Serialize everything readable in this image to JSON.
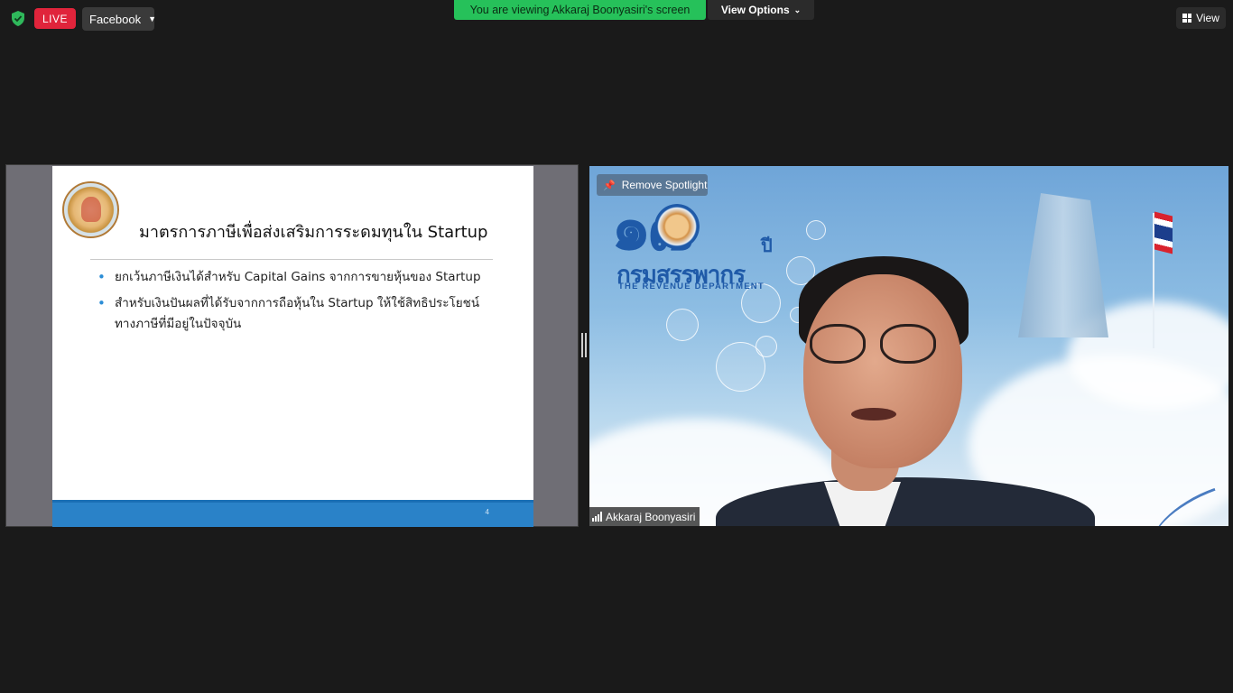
{
  "toolbar": {
    "live_label": "LIVE",
    "stream_target": "Facebook",
    "viewing_banner": "You are viewing Akkaraj Boonyasiri's screen",
    "view_options_label": "View Options",
    "view_label": "View"
  },
  "slide": {
    "title": "มาตรการภาษีเพื่อส่งเสริมการระดมทุนใน Startup",
    "bullets": [
      "ยกเว้นภาษีเงินได้สำหรับ Capital Gains จากการขายหุ้นของ Startup",
      "สำหรับเงินปันผลที่ได้รับจากการถือหุ้นใน Startup ให้ใช้สิทธิประโยชน์ทางภาษีที่มีอยู่ในปัจจุบัน"
    ],
    "page_number": "4"
  },
  "video": {
    "remove_spotlight_label": "Remove Spotlight",
    "participant_name": "Akkaraj Boonyasiri",
    "background_logo": {
      "number": "๑๗",
      "suffix": "ปี",
      "thai_name": "กรมสรรพากร",
      "english_name": "THE REVENUE DEPARTMENT"
    }
  },
  "colors": {
    "live_red": "#e0243b",
    "viewing_green": "#26c15a",
    "slide_footer_blue": "#2a82c8",
    "background": "#1a1a1a"
  }
}
